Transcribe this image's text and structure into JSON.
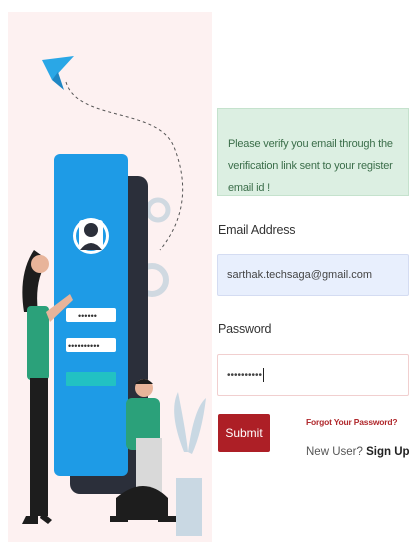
{
  "alert": {
    "message": "Please verify you email through the verification link sent to your register email id !"
  },
  "form": {
    "email_label": "Email Address",
    "email_value": "sarthak.techsaga@gmail.com",
    "password_label": "Password",
    "password_value": "••••••••••",
    "submit_label": "Submit",
    "forgot_label": "Forgot Your Password?",
    "new_user_text": "New User?",
    "signup_label": "Sign Up"
  },
  "illustration": {
    "phone_username_mask": "••••••",
    "phone_password_mask": "••••••••••"
  },
  "colors": {
    "left_bg": "#fdf1f1",
    "alert_bg": "#dcefe2",
    "phone_blue": "#1e9be6",
    "submit_red": "#ad1f26",
    "forgot_red": "#b0282c"
  }
}
